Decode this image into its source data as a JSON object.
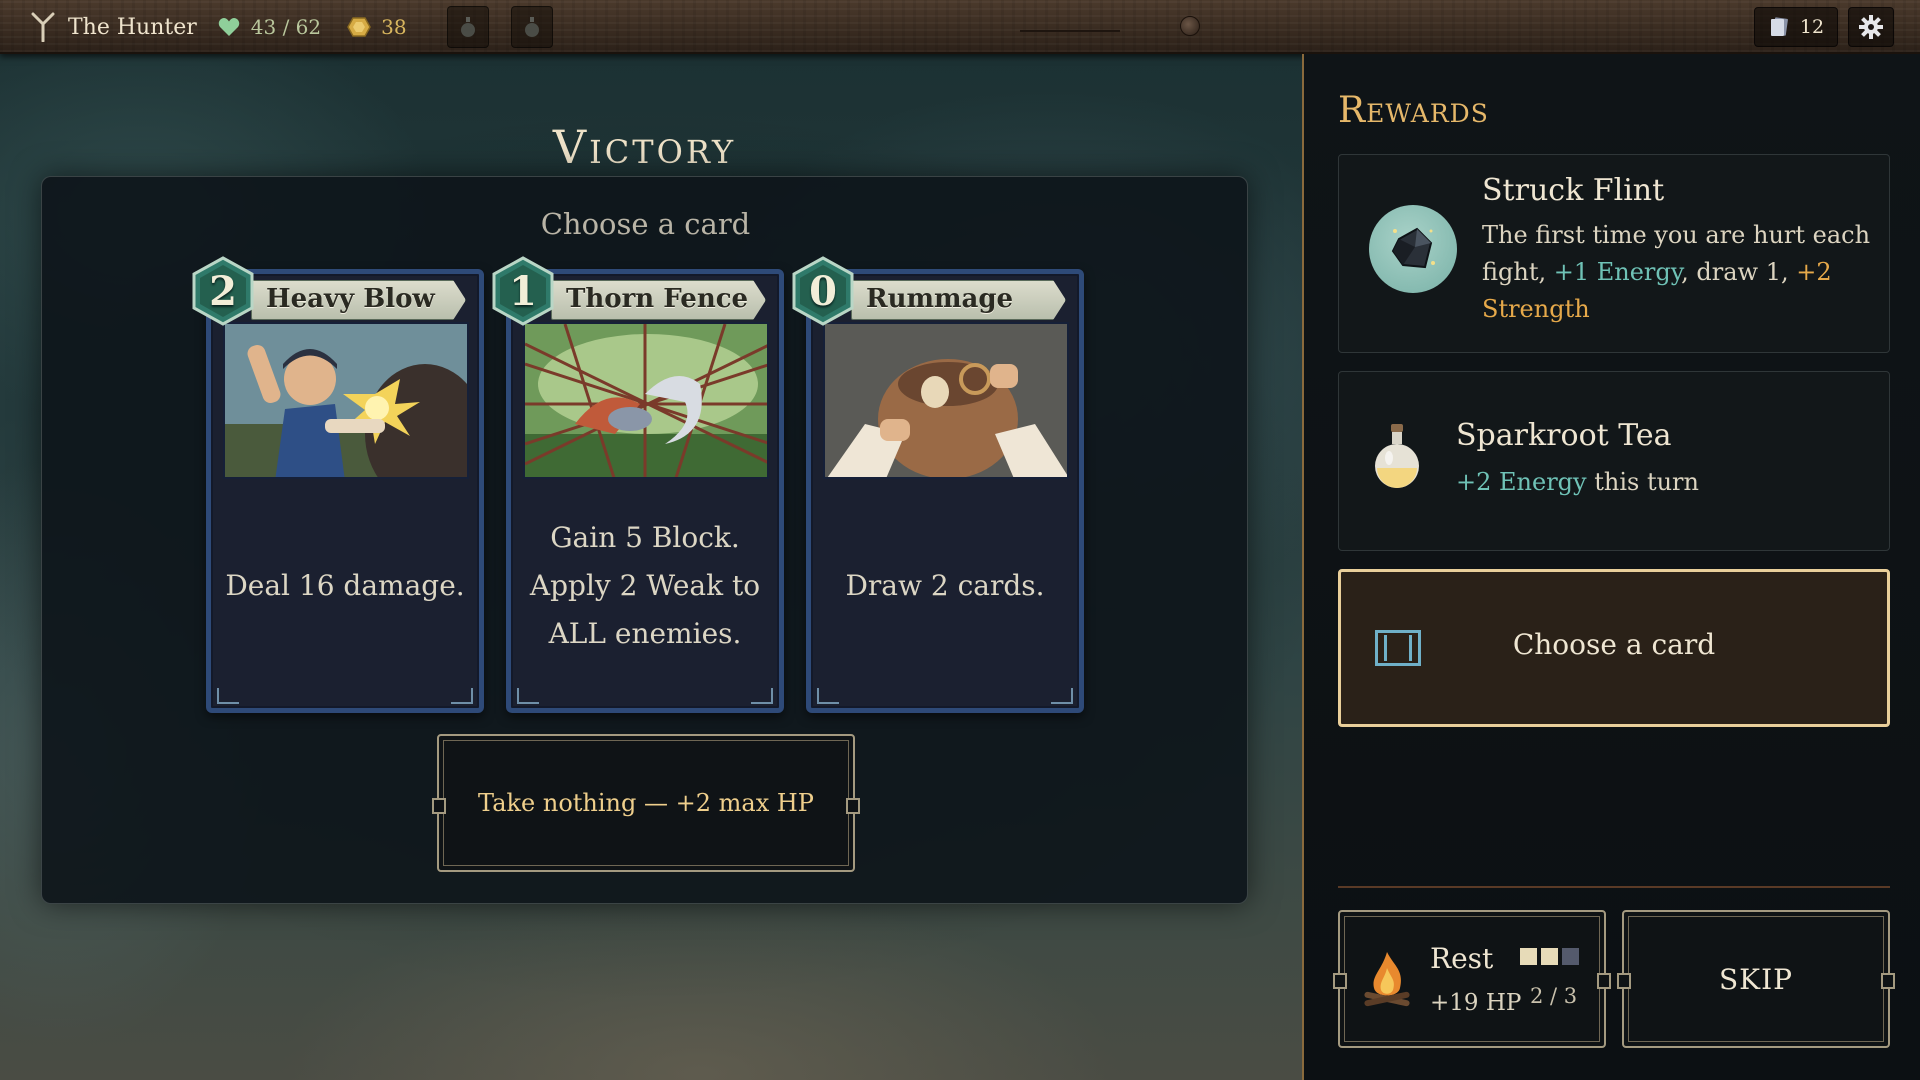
{
  "topbar": {
    "hero_name": "The Hunter",
    "hp": "43 / 62",
    "gold": "38",
    "deck_count": "12",
    "potion_slots": 2,
    "icons": [
      "class-rune-icon",
      "heart-icon",
      "gold-coin-icon",
      "potion-slot-icon",
      "deck-icon",
      "gear-icon"
    ]
  },
  "victory": {
    "title": "Victory",
    "prompt": "Choose a card",
    "cards": [
      {
        "cost": "2",
        "name": "Heavy Blow",
        "description": "Deal 16 damage."
      },
      {
        "cost": "1",
        "name": "Thorn Fence",
        "description": "Gain 5 Block. Apply 2 Weak to ALL enemies."
      },
      {
        "cost": "0",
        "name": "Rummage",
        "description": "Draw 2 cards."
      }
    ],
    "take_nothing": "Take nothing — +2 max HP"
  },
  "rewards": {
    "title": "Rewards",
    "relic": {
      "name": "Struck Flint",
      "desc_1": "The first time you are hurt each fight, ",
      "desc_kw1": "+1 Energy",
      "desc_2": ", draw 1, ",
      "desc_kw2": "+2 Strength"
    },
    "potion": {
      "name": "Sparkroot Tea",
      "desc_kw": "+2 Energy",
      "desc_rest": " this turn"
    },
    "card_pick": {
      "label": "Choose a card"
    },
    "rest": {
      "label": "Rest",
      "heal": "+19 HP",
      "count": "2 / 3",
      "charges_used": 2,
      "charges_total": 3
    },
    "skip": {
      "label": "SKIP"
    }
  },
  "colors": {
    "accent_gold": "#e6b86a",
    "keyword_green": "#6fc2b6",
    "keyword_gold": "#e6a94a",
    "card_border": "#2e4a78",
    "cost_gem": "#2f7a6a"
  }
}
